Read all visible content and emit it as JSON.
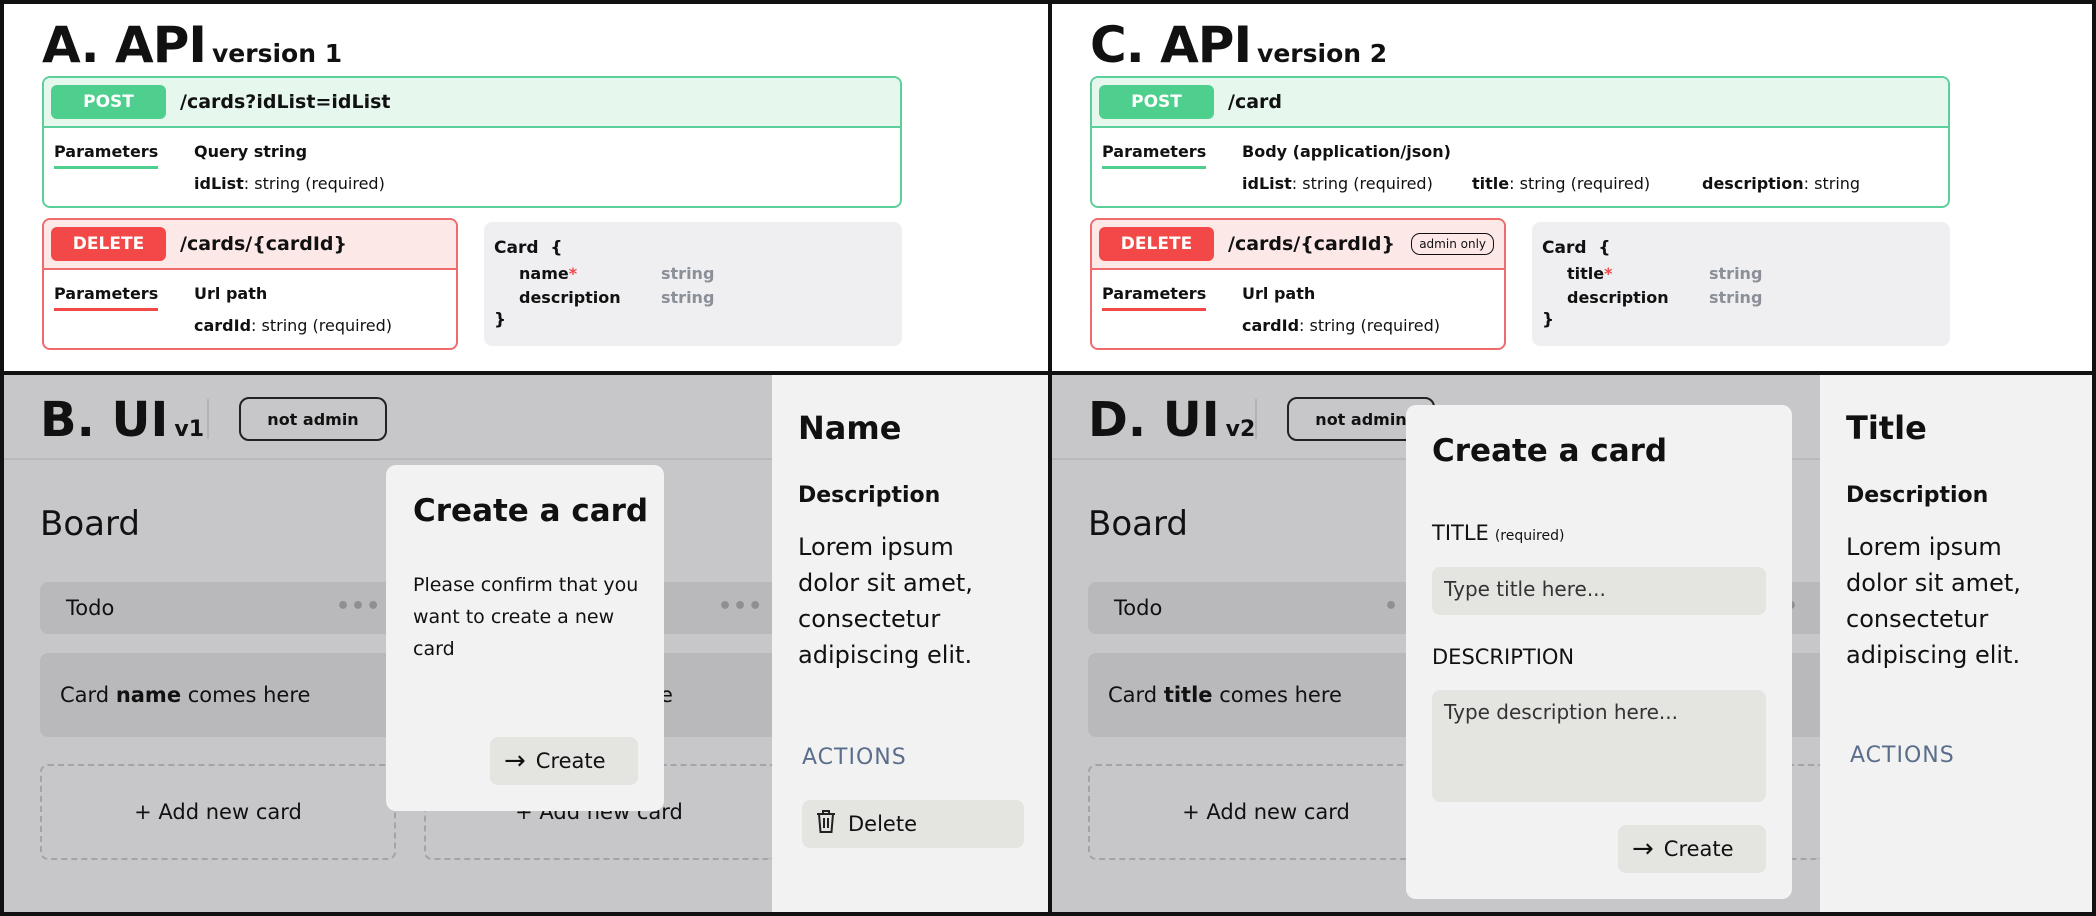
{
  "panelA": {
    "title": "A. API",
    "subtitle": "version 1",
    "post": {
      "method": "POST",
      "path": "/cards?idList=idList",
      "params_label": "Parameters",
      "params_type": "Query string",
      "params": [
        {
          "name": "idList",
          "desc": ": string (required)"
        }
      ]
    },
    "delete": {
      "method": "DELETE",
      "path": "/cards/{cardId}",
      "params_label": "Parameters",
      "params_type": "Url path",
      "params": [
        {
          "name": "cardId",
          "desc": ": string (required)"
        }
      ]
    },
    "schema": {
      "name": "Card",
      "open": "{",
      "close": "}",
      "fields": [
        {
          "name": "name",
          "required": "*",
          "type": "string"
        },
        {
          "name": "description",
          "required": "",
          "type": "string"
        }
      ]
    }
  },
  "panelC": {
    "title": "C. API",
    "subtitle": "version 2",
    "post": {
      "method": "POST",
      "path": "/card",
      "params_label": "Parameters",
      "params_type": "Body (application/json)",
      "params": [
        {
          "name": "idList",
          "desc": ": string (required)"
        },
        {
          "name": "title",
          "desc": ": string (required)"
        },
        {
          "name": "description",
          "desc": ": string"
        }
      ]
    },
    "delete": {
      "method": "DELETE",
      "path": "/cards/{cardId}",
      "badge": "admin only",
      "params_label": "Parameters",
      "params_type": "Url path",
      "params": [
        {
          "name": "cardId",
          "desc": ": string (required)"
        }
      ]
    },
    "schema": {
      "name": "Card",
      "open": "{",
      "close": "}",
      "fields": [
        {
          "name": "title",
          "required": "*",
          "type": "string"
        },
        {
          "name": "description",
          "required": "",
          "type": "string"
        }
      ]
    }
  },
  "panelB": {
    "title": "B. UI",
    "subtitle": "v1",
    "role_pill": "not admin",
    "board_title": "Board",
    "column_label": "Todo",
    "dots": "•••",
    "card_prefix": "Card ",
    "card_field": "name",
    "card_suffix": " comes here",
    "card_right_fragment": "e",
    "add_card": "+ Add new card",
    "modal": {
      "title": "Create a card",
      "text": "Please confirm that you want to create a new card",
      "button": "Create"
    },
    "side": {
      "heading": "Name",
      "desc_label": "Description",
      "desc_text": "Lorem ipsum dolor sit amet, consectetur adipiscing elit.",
      "actions_label": "ACTIONS",
      "delete_button": "Delete"
    }
  },
  "panelD": {
    "title": "D. UI",
    "subtitle": "v2",
    "role_pill": "not admin",
    "board_title": "Board",
    "column_label": "Todo",
    "dots": "•",
    "card_prefix": "Card ",
    "card_field": "title",
    "card_suffix": " comes here",
    "add_card": "+ Add new card",
    "modal": {
      "title": "Create a card",
      "title_label": "TITLE",
      "title_required": "(required)",
      "title_placeholder": "Type title here...",
      "desc_label": "DESCRIPTION",
      "desc_placeholder": "Type description here...",
      "button": "Create"
    },
    "side": {
      "heading": "Title",
      "desc_label": "Description",
      "desc_text": "Lorem ipsum dolor sit amet, consectetur adipiscing elit.",
      "actions_label": "ACTIONS"
    }
  },
  "icons": {
    "arrow": "arrow-right-icon",
    "trash": "trash-icon",
    "more": "more-dots-icon"
  },
  "colors": {
    "post_green": "#4fcf8e",
    "delete_red": "#f24848",
    "overlay_gray": "#c7c7ca",
    "actions_blue": "#5a6d8a"
  }
}
